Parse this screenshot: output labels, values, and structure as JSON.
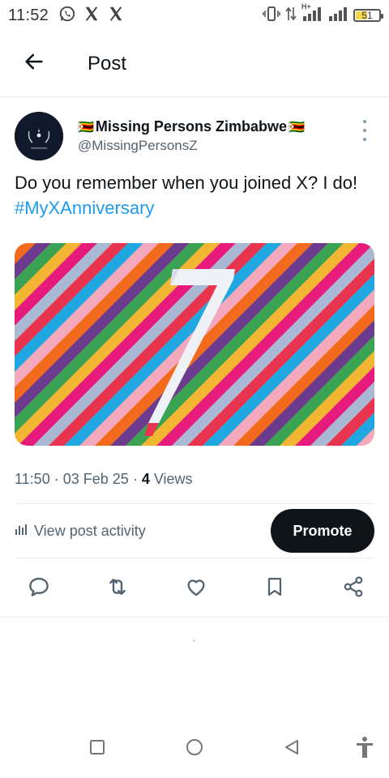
{
  "status_bar": {
    "time": "11:52",
    "app_icons": [
      "whatsapp-icon",
      "x-icon",
      "x-icon"
    ],
    "network_label": "H+",
    "battery": "51",
    "battery_level_percent": 51
  },
  "header": {
    "title": "Post",
    "back_icon": "arrow-left-icon"
  },
  "tweet": {
    "author_name": "Missing Persons Zimbabwe",
    "author_flag": "🇿🇼",
    "author_handle": "@MissingPersonsZ",
    "text_before": "Do you remember when you joined X? I do! ",
    "hashtag": "#MyXAnniversary",
    "media_number": "7",
    "time": "11:50",
    "date": "03 Feb 25",
    "views_count": "4",
    "views_label": "Views"
  },
  "activity": {
    "link_label": "View post activity",
    "promote_label": "Promote"
  },
  "actions": [
    "reply-icon",
    "repost-icon",
    "like-icon",
    "bookmark-icon",
    "share-icon"
  ],
  "colors": {
    "accent": "#1d9bf0",
    "text_primary": "#0f1419",
    "text_secondary": "#536471",
    "button_dark": "#0f1419",
    "stripes": [
      "#e8344e",
      "#1ea7e0",
      "#f4a8be",
      "#f26b1d",
      "#6c3b8e",
      "#3aa353",
      "#f2b632",
      "#e71b7e",
      "#a9b8d4"
    ]
  },
  "nav_bar": [
    "recents-square-icon",
    "home-circle-icon",
    "back-triangle-icon",
    "accessibility-icon"
  ]
}
